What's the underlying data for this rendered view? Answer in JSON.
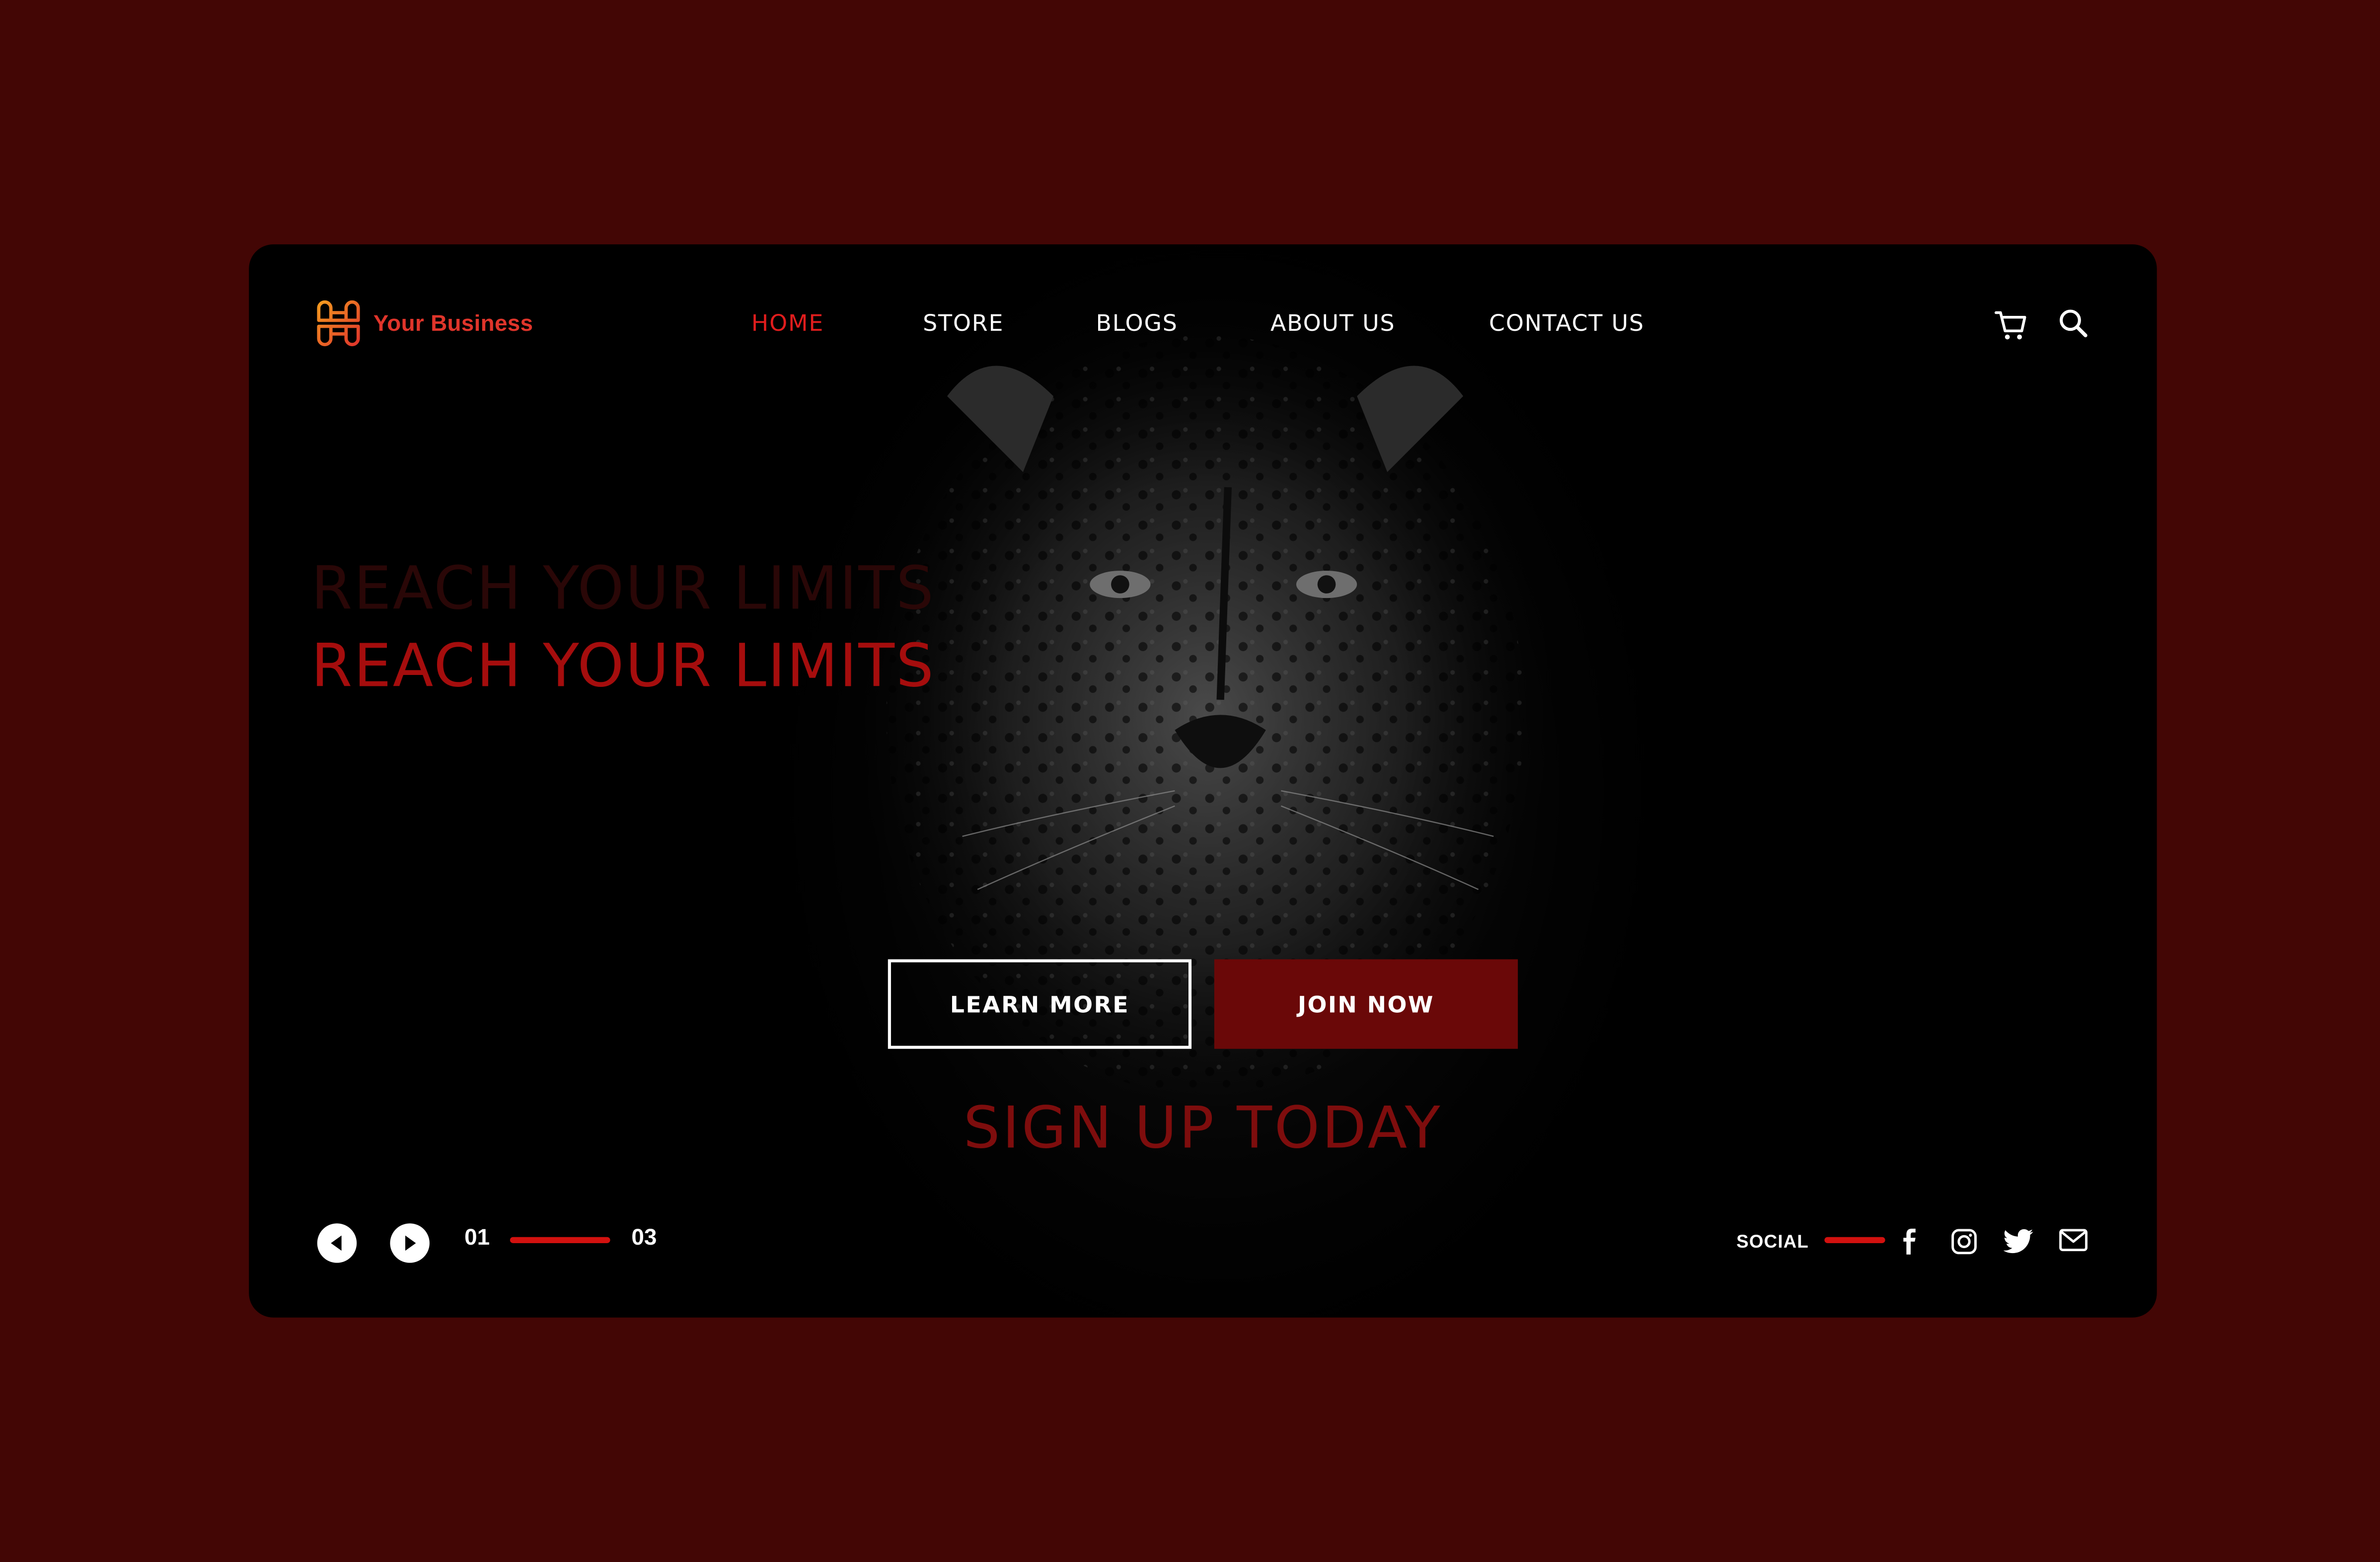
{
  "brand": {
    "name": "Your Business"
  },
  "nav": {
    "items": [
      {
        "label": "HOME",
        "active": true
      },
      {
        "label": "STORE",
        "active": false
      },
      {
        "label": "BLOGS",
        "active": false
      },
      {
        "label": "ABOUT US",
        "active": false
      },
      {
        "label": "CONTACT US",
        "active": false
      }
    ],
    "icons": [
      "cart-icon",
      "search-icon"
    ]
  },
  "hero": {
    "title_ghost": "REACH YOUR LIMITS",
    "title": "REACH YOUR LIMITS",
    "learn_more": "LEARN MORE",
    "join_now": "JOIN NOW",
    "signup": "SIGN UP TODAY"
  },
  "slider": {
    "current": "01",
    "total": "03"
  },
  "social": {
    "label": "SOCIAL",
    "icons": [
      "facebook-icon",
      "instagram-icon",
      "twitter-icon",
      "mail-icon"
    ]
  },
  "colors": {
    "background": "#430605",
    "accent": "#e11d1d",
    "cta": "#6a0808",
    "card": "#000000"
  }
}
